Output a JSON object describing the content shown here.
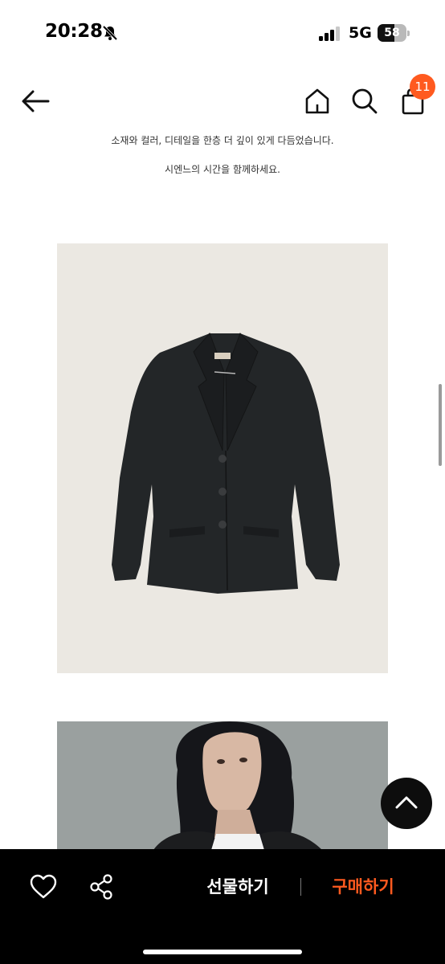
{
  "status_bar": {
    "time": "20:28",
    "network": "5G",
    "battery_percent": "58",
    "battery_level": 0.58,
    "icons": [
      "bell-slash-icon",
      "signal-icon",
      "battery-icon"
    ]
  },
  "header": {
    "icons": [
      "arrow-left-icon",
      "home-icon",
      "search-icon",
      "bag-icon"
    ],
    "cart_count": "11",
    "badge_color": "#ff5a1f"
  },
  "description": {
    "line1": "소재와 컬러, 디테일을 한층 더 깊이 있게 다듬었습니다.",
    "line2": "시엔느의 시간을 함께하세요."
  },
  "images": {
    "product_image": "jacket-photo",
    "model_image": "model-photo"
  },
  "bottom_bar": {
    "gift_label": "선물하기",
    "buy_label": "구매하기",
    "buy_color": "#ff5a1f",
    "icons": [
      "heart-icon",
      "share-icon"
    ]
  },
  "scroll_top": {
    "icon": "chevron-up-icon"
  }
}
